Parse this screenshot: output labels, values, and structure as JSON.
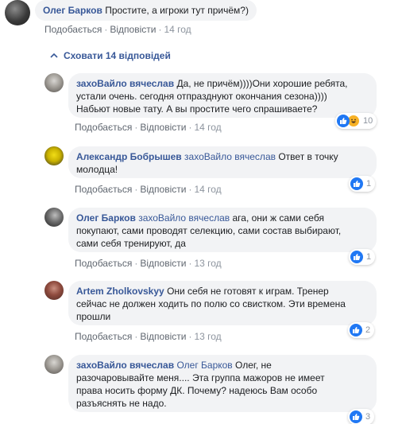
{
  "top_comment": {
    "author": "Олег Барков",
    "text": "Простите, а игроки тут причём?)",
    "like_label": "Подобається",
    "reply_label": "Відповісти",
    "time": "14 год"
  },
  "collapse": {
    "label": "Сховати 14 відповідей"
  },
  "replies": [
    {
      "author": "захоВайло вячеслав",
      "mention": "",
      "lines": [
        "Да, не причём))))Они хорошие ребята,",
        "устали очень. сегодня отпразднуют окончания сезона))))",
        "Набьют новые тату. А вы простите чего спрашиваете?"
      ],
      "like_label": "Подобається",
      "reply_label": "Відповісти",
      "time": "14 год",
      "reaction_count": "10",
      "reactions": [
        "like-icon",
        "haha-icon"
      ]
    },
    {
      "author": "Александр Бобрышев",
      "mention": "захоВайло вячеслав",
      "lines": [
        "Ответ в точку",
        "молодца!"
      ],
      "like_label": "Подобається",
      "reply_label": "Відповісти",
      "time": "14 год",
      "reaction_count": "1",
      "reactions": [
        "like-icon"
      ]
    },
    {
      "author": "Олег Барков",
      "mention": "захоВайло вячеслав",
      "lines": [
        "ага, они ж сами себя",
        "покупают, сами проводят селекцию, сами состав выбирают,",
        "сами себя тренируют, да"
      ],
      "like_label": "Подобається",
      "reply_label": "Відповісти",
      "time": "13 год",
      "reaction_count": "1",
      "reactions": [
        "like-icon"
      ]
    },
    {
      "author": "Artem Zholkovskyy",
      "mention": "",
      "lines": [
        "Они себя не готовят к играм. Тренер",
        "сейчас не должен ходить по полю со свистком. Эти времена",
        "прошли"
      ],
      "like_label": "Подобається",
      "reply_label": "Відповісти",
      "time": "13 год",
      "reaction_count": "2",
      "reactions": [
        "like-icon"
      ]
    },
    {
      "author": "захоВайло вячеслав",
      "mention": "Олег Барков",
      "lines": [
        "Олег, не",
        "разочаровывайте меня.... Эта группа мажоров не имеет",
        "права носить форму ДК. Почему? надеюсь Вам особо",
        "разъяснять не надо."
      ],
      "reaction_count": "3",
      "reactions": [
        "like-icon"
      ]
    }
  ],
  "colors": {
    "link": "#385898",
    "bubble": "#f2f3f5",
    "meta": "#8d949e",
    "like": "#2078f4",
    "haha": "#f7b125"
  }
}
